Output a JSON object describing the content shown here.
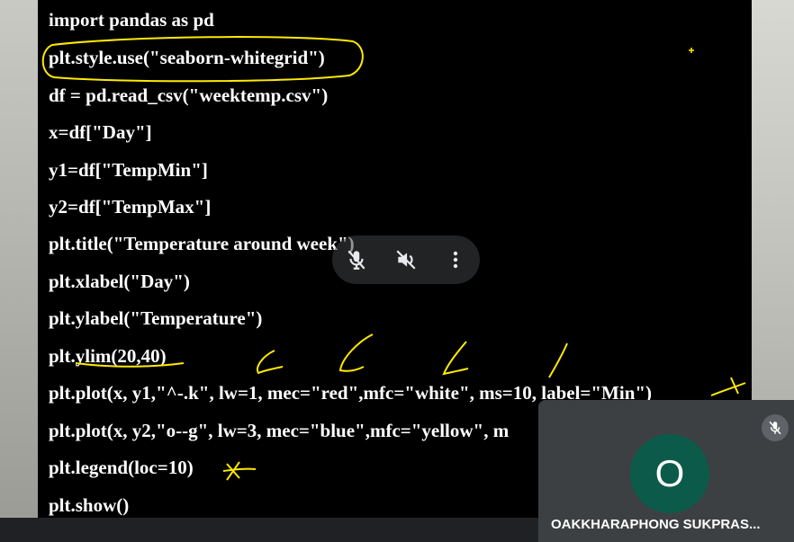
{
  "slide": {
    "code_lines": [
      "import pandas as pd",
      "plt.style.use(\"seaborn-whitegrid\")",
      "df = pd.read_csv(\"weektemp.csv\")",
      "x=df[\"Day\"]",
      "y1=df[\"TempMin\"]",
      "y2=df[\"TempMax\"]",
      "plt.title(\"Temperature around week\")",
      "plt.xlabel(\"Day\")",
      "plt.ylabel(\"Temperature\")",
      "plt.ylim(20,40)",
      "plt.plot(x, y1,\"^-.k\", lw=1, mec=\"red\",mfc=\"white\", ms=10, label=\"Min\")",
      "plt.plot(x, y2,\"o--g\", lw=3, mec=\"blue\",mfc=\"yellow\", m",
      "plt.legend(loc=10)",
      "plt.show()"
    ]
  },
  "media_controls": {
    "mic_icon": "mic-off-icon",
    "volume_icon": "volume-off-icon",
    "more_icon": "more-vert-icon"
  },
  "participant": {
    "initial": "O",
    "name": "OAKKHARAPHONG SUKPRAS...",
    "avatar_color": "#0c5a4a",
    "mic_status_icon": "mic-off-icon"
  },
  "annotation_color": "#ffea00"
}
